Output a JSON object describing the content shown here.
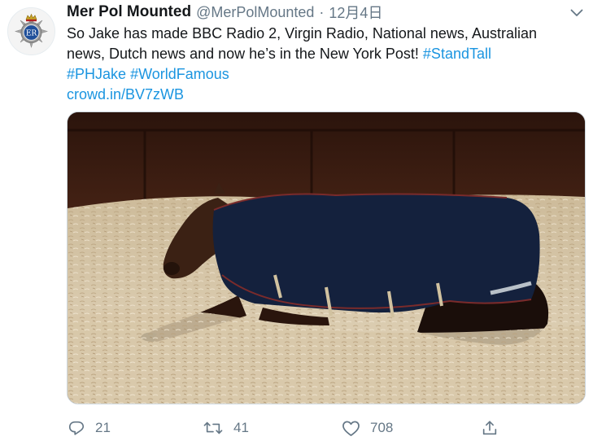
{
  "tweet": {
    "display_name": "Mer Pol Mounted",
    "handle": "@MerPolMounted",
    "separator": "·",
    "time": "12月4日",
    "text_lines": [
      "So Jake has made BBC Radio 2, Virgin Radio, National news, Australian",
      "news, Dutch news and now he’s in the New York Post! "
    ],
    "hashtag_standtall": "#StandTall",
    "hashtag_phjake": "#PHJake",
    "hashtag_worldfamous": "#WorldFamous",
    "hashtag_space": " ",
    "link": "crowd.in/BV7zWB",
    "avatar_lettering": "ER",
    "image_subject": "horse lying in wood-shavings bedding wearing a navy rug"
  },
  "actions": {
    "reply": {
      "icon": "reply-icon",
      "count": "21"
    },
    "retweet": {
      "icon": "retweet-icon",
      "count": "41"
    },
    "like": {
      "icon": "heart-icon",
      "count": "708"
    },
    "share": {
      "icon": "share-icon"
    }
  },
  "colors": {
    "accent": "#1b95e0",
    "text": "#14171a",
    "secondary": "#657786",
    "border": "#ccd6dd"
  }
}
